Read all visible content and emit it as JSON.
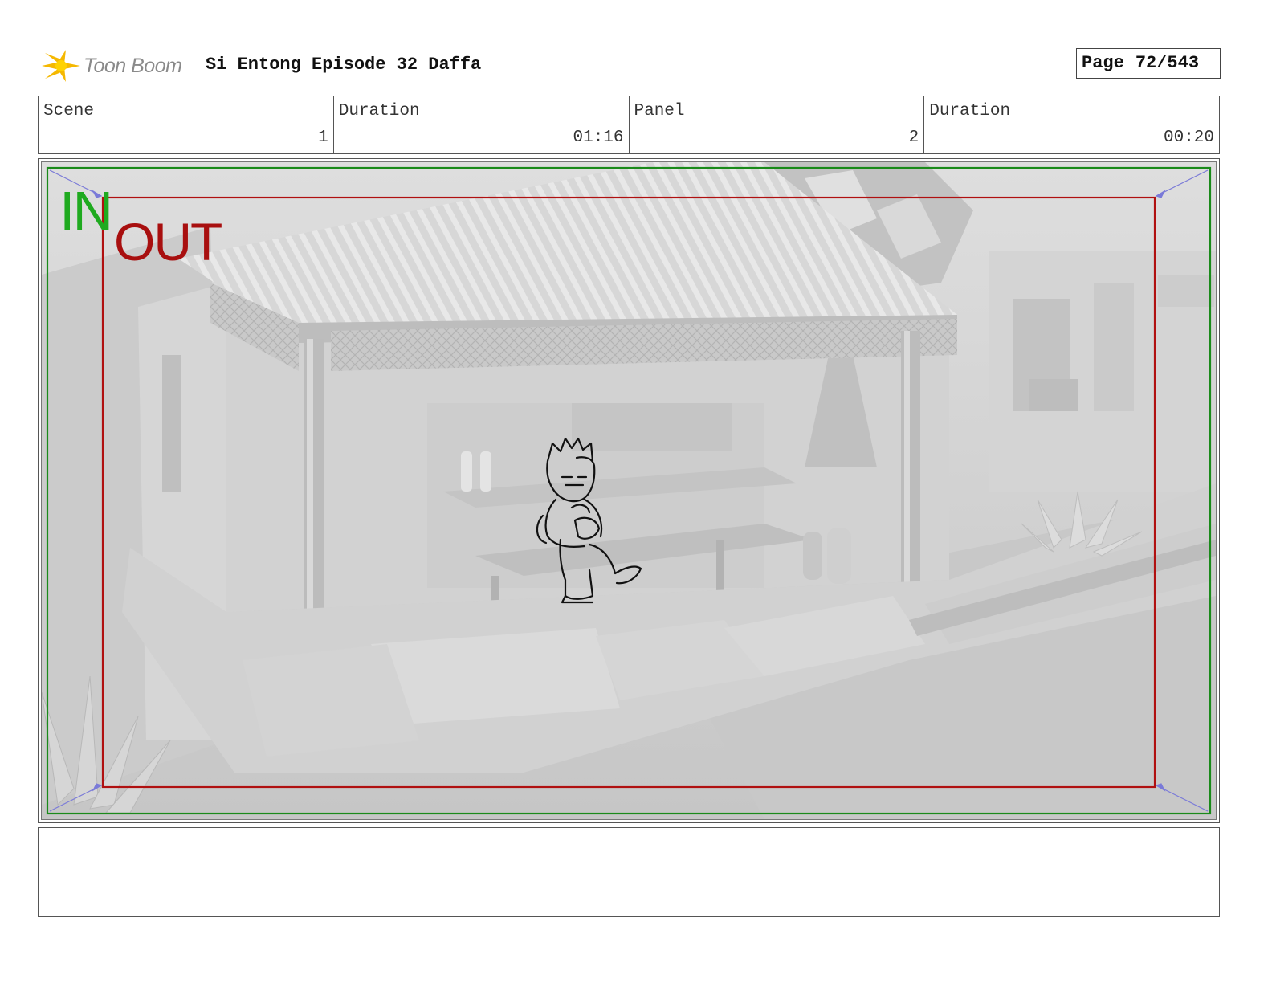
{
  "header": {
    "logo_text": "Toon Boom",
    "title": "Si Entong Episode 32 Daffa",
    "page_label": "Page",
    "page_value": "72/543"
  },
  "info": {
    "scene_label": "Scene",
    "scene_value": "1",
    "scene_duration_label": "Duration",
    "scene_duration_value": "01:16",
    "panel_label": "Panel",
    "panel_value": "2",
    "panel_duration_label": "Duration",
    "panel_duration_value": "00:20"
  },
  "panel": {
    "in_label": "IN",
    "out_label": "OUT",
    "in_frame_color": "#1a8a1a",
    "out_frame_color": "#b01010"
  },
  "notes": {
    "text": ""
  }
}
